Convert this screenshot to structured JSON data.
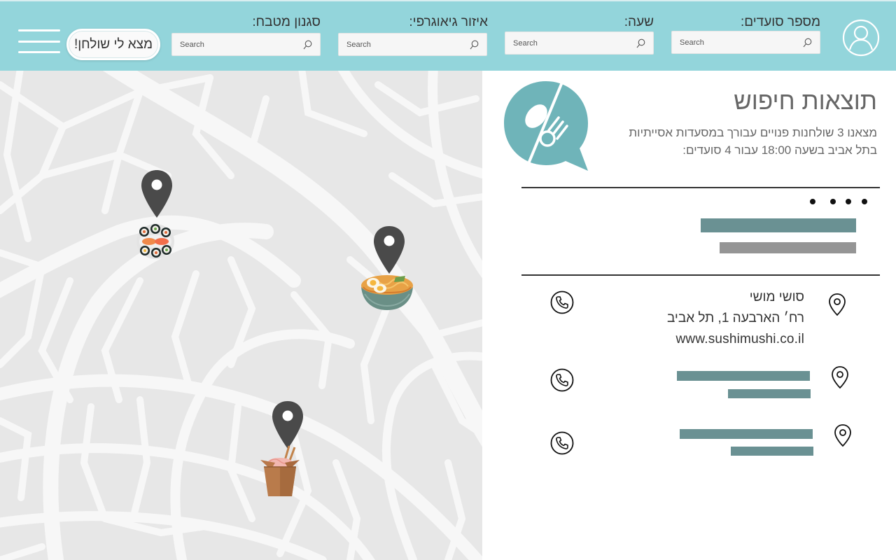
{
  "header": {
    "fields": [
      {
        "label": "מספר סועדים:",
        "placeholder": "Search"
      },
      {
        "label": "שעה:",
        "placeholder": "Search"
      },
      {
        "label": "איזור גיאוגרפי:",
        "placeholder": "Search"
      },
      {
        "label": "סגנון מטבח:",
        "placeholder": "Search"
      }
    ],
    "find_button": "מצא לי שולחן!"
  },
  "results": {
    "title": "תוצאות חיפוש",
    "description": "מצאנו 3 שולחנות פנויים עבורך במסעדות אסייתיות בתל אביב בשעה 18:00 עבור 4 סועדים:",
    "restaurants": [
      {
        "name": "סושי מושי",
        "address": "רח׳ הארבעה 1, תל אביב",
        "website": "www.sushimushi.co.il"
      }
    ]
  },
  "map": {
    "markers": [
      {
        "food": "sushi"
      },
      {
        "food": "ramen"
      },
      {
        "food": "noodle-box"
      }
    ]
  },
  "colors": {
    "header_bg": "#93d5db",
    "accent_teal": "#6fb4b9",
    "bar_teal": "#6a9193",
    "bar_gray": "#959595",
    "pin": "#4a4a4a"
  },
  "icons": [
    "user-icon",
    "search-icon",
    "hamburger-menu-icon",
    "map-pin-icon",
    "location-pin-icon",
    "phone-icon",
    "fork-and-spoon-chat-icon"
  ]
}
